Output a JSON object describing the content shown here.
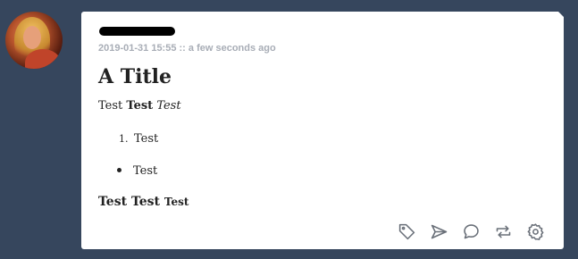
{
  "post": {
    "timestamp": "2019-01-31 15:55 :: a few seconds ago",
    "title": "A Title",
    "line1": {
      "plain": "Test",
      "bold": "Test",
      "italic": "Test"
    },
    "ordered_list": [
      {
        "number": "1.",
        "text": "Test"
      }
    ],
    "unordered_list": [
      {
        "text": "Test"
      }
    ],
    "line3": {
      "part1": "Test",
      "part2": "Test",
      "part3": "Test"
    }
  },
  "actions": [
    {
      "icon": "tag-icon"
    },
    {
      "icon": "send-icon"
    },
    {
      "icon": "comment-icon"
    },
    {
      "icon": "reblog-icon"
    },
    {
      "icon": "gear-icon"
    }
  ],
  "colors": {
    "background": "#36465d",
    "card": "#ffffff",
    "timestamp": "#a8adb6",
    "icon": "#6a7079"
  }
}
